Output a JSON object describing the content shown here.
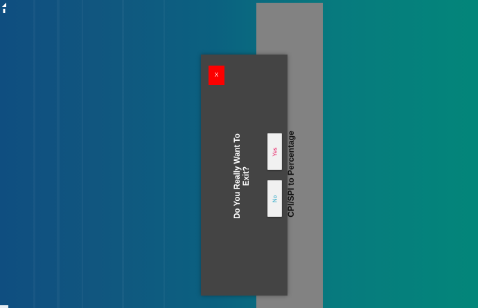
{
  "status_bar": {
    "icons": [
      "signal-icon",
      "battery-icon"
    ],
    "signal_glyph": "◢",
    "battery_glyph": "▮"
  },
  "background_screen": {
    "title": "CPI/SPI to Percentage"
  },
  "exit_dialog": {
    "close_label": "X",
    "message": "Do You Really Want To Exit?",
    "yes_label": "Yes",
    "no_label": "No"
  },
  "colors": {
    "dialog_background": "#444444",
    "close_button": "#fd0000",
    "yes_text": "#e91e63",
    "no_text": "#26a6c6",
    "behind_panel": "#828282"
  }
}
